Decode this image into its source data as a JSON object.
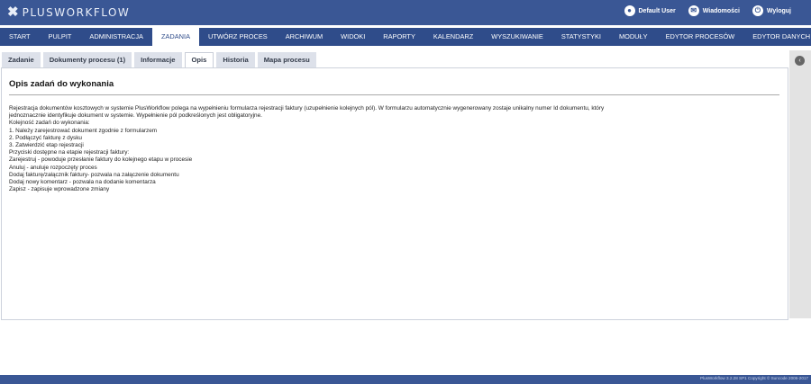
{
  "header": {
    "logo_text": "PLUSWORKFLOW",
    "logo_icon": "x-logo-icon",
    "user_links": [
      {
        "icon": "user-icon",
        "label": "Default User"
      },
      {
        "icon": "envelope-icon",
        "label": "Wiadomości"
      },
      {
        "icon": "power-icon",
        "label": "Wyloguj"
      }
    ]
  },
  "nav": {
    "items": [
      "START",
      "PULPIT",
      "ADMINISTRACJA",
      "ZADANIA",
      "UTWÓRZ PROCES",
      "ARCHIWUM",
      "WIDOKI",
      "RAPORTY",
      "KALENDARZ",
      "WYSZUKIWANIE",
      "STATYSTYKI",
      "MODUŁY",
      "EDYTOR PROCESÓW",
      "EDYTOR DANYCH"
    ],
    "active": "ZADANIA"
  },
  "tabs": {
    "items": [
      "Zadanie",
      "Dokumenty procesu (1)",
      "Informacje",
      "Opis",
      "Historia",
      "Mapa procesu"
    ],
    "active": "Opis"
  },
  "content": {
    "title": "Opis zadań do wykonania",
    "lines": [
      "Rejestracja dokumentów kosztowych w systemie PlusWorkflow polega na wypełnieniu formularza rejestracji faktury (uzupełnienie kolejnych pól). W formularzu automatycznie wygenerowany zostaje unikalny numer Id dokumentu, który",
      "jednoznacznie identyfikuje dokument w systemie. Wypełnienie pól podkreślonych jest obligatoryjne.",
      "Kolejność zadań do wykonania:",
      "1. Należy zarejestrować dokument zgodnie z formularzem",
      "2. Podłączyć fakturę z dysku",
      "3. Zatwierdzić etap rejestracji",
      "Przyciski dostępne na etapie rejestracji faktury:",
      "Zarejestruj - powoduje przesłanie faktury do kolejnego etapu w procesie",
      "Anuluj - anuluje rozpoczęty proces",
      "Dodaj fakturę/załącznik faktury- pozwala na załączenie dokumentu",
      "Dodaj nowy komentarz - pozwala na dodanie komentarza",
      "Zapisz - zapisuje wprowadzone zmiany"
    ]
  },
  "side_panel": {
    "icon": "chevron-left-icon",
    "glyph": "‹"
  },
  "footer": {
    "text": "PlusWorkflow 3.2.28 SP1 Copyright © Suncode 2006-2017"
  },
  "colors": {
    "header_bg": "#3a5795",
    "nav_bg": "#2f4c8a",
    "tab_bg": "#dde1ea",
    "footer_bg": "#3a5795"
  }
}
